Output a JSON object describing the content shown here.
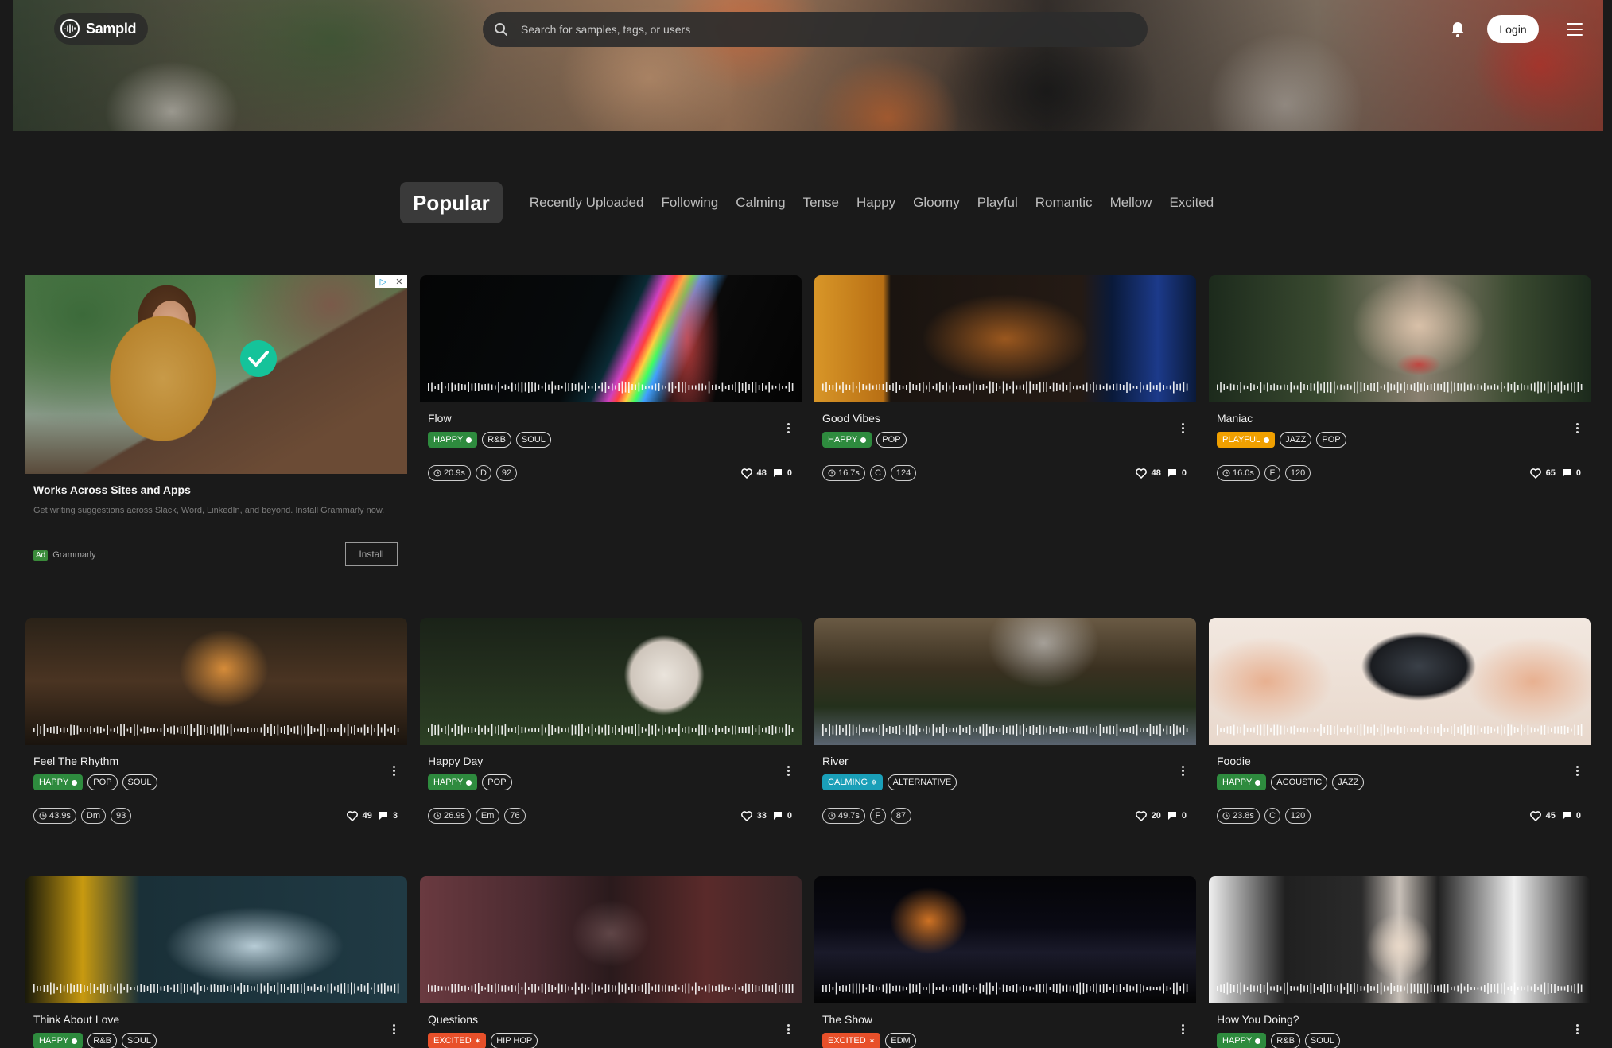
{
  "header": {
    "logo_text": "Sampld",
    "search_placeholder": "Search for samples, tags, or users",
    "login_label": "Login"
  },
  "tabs": [
    {
      "label": "Popular",
      "active": true
    },
    {
      "label": "Recently Uploaded"
    },
    {
      "label": "Following"
    },
    {
      "label": "Calming"
    },
    {
      "label": "Tense"
    },
    {
      "label": "Happy"
    },
    {
      "label": "Gloomy"
    },
    {
      "label": "Playful"
    },
    {
      "label": "Romantic"
    },
    {
      "label": "Mellow"
    },
    {
      "label": "Excited"
    }
  ],
  "ad": {
    "title": "Works Across Sites and Apps",
    "description": "Get writing suggestions across Slack, Word, LinkedIn, and beyond. Install Grammarly now.",
    "badge": "Ad",
    "advertiser": "Grammarly",
    "cta": "Install"
  },
  "colors": {
    "happy": "#2e8b3e",
    "playful": "#f0a000",
    "calming": "#1a9fb8",
    "excited": "#e8502a"
  },
  "samples": [
    {
      "title": "Flow",
      "mood": "HAPPY",
      "genres": [
        "R&B",
        "SOUL"
      ],
      "duration": "20.9s",
      "key": "D",
      "bpm": "92",
      "likes": "48",
      "comments": "0"
    },
    {
      "title": "Good Vibes",
      "mood": "HAPPY",
      "genres": [
        "POP"
      ],
      "duration": "16.7s",
      "key": "C",
      "bpm": "124",
      "likes": "48",
      "comments": "0"
    },
    {
      "title": "Maniac",
      "mood": "PLAYFUL",
      "genres": [
        "JAZZ",
        "POP"
      ],
      "duration": "16.0s",
      "key": "F",
      "bpm": "120",
      "likes": "65",
      "comments": "0"
    },
    {
      "title": "Feel The Rhythm",
      "mood": "HAPPY",
      "genres": [
        "POP",
        "SOUL"
      ],
      "duration": "43.9s",
      "key": "Dm",
      "bpm": "93",
      "likes": "49",
      "comments": "3"
    },
    {
      "title": "Happy Day",
      "mood": "HAPPY",
      "genres": [
        "POP"
      ],
      "duration": "26.9s",
      "key": "Em",
      "bpm": "76",
      "likes": "33",
      "comments": "0"
    },
    {
      "title": "River",
      "mood": "CALMING",
      "genres": [
        "ALTERNATIVE"
      ],
      "duration": "49.7s",
      "key": "F",
      "bpm": "87",
      "likes": "20",
      "comments": "0"
    },
    {
      "title": "Foodie",
      "mood": "HAPPY",
      "genres": [
        "ACOUSTIC",
        "JAZZ"
      ],
      "duration": "23.8s",
      "key": "C",
      "bpm": "120",
      "likes": "45",
      "comments": "0"
    },
    {
      "title": "Think About Love",
      "mood": "HAPPY",
      "genres": [
        "R&B",
        "SOUL"
      ]
    },
    {
      "title": "Questions",
      "mood": "EXCITED",
      "genres": [
        "HIP HOP"
      ]
    },
    {
      "title": "The Show",
      "mood": "EXCITED",
      "genres": [
        "EDM"
      ]
    },
    {
      "title": "How You Doing?",
      "mood": "HAPPY",
      "genres": [
        "R&B",
        "SOUL"
      ]
    }
  ]
}
